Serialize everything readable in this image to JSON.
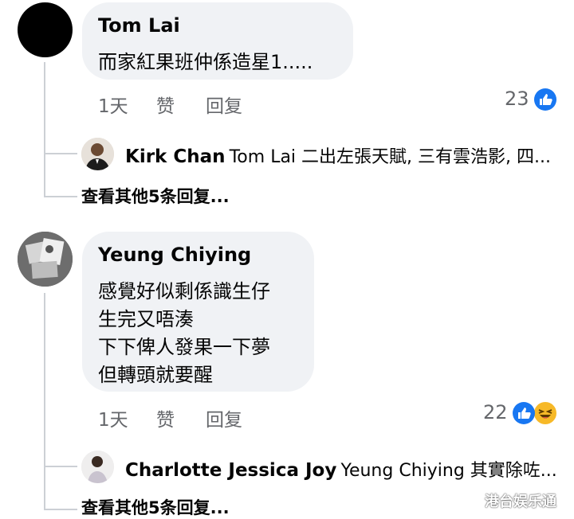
{
  "comments": [
    {
      "author": "Tom Lai",
      "lines": [
        "而家紅果班仲係造星1....."
      ],
      "time": "1天",
      "like_label": "赞",
      "reply_label": "回复",
      "reaction_count": "23",
      "reactions": [
        "like-icon"
      ],
      "reply_preview": {
        "author": "Kirk Chan",
        "text": "Tom Lai 二出左張天賦, 三有雲浩影, 四..."
      },
      "more_replies": "查看其他5条回复..."
    },
    {
      "author": "Yeung Chiying",
      "lines": [
        "感覺好似剩係識生仔",
        "生完又唔湊",
        "下下俾人發果一下夢",
        "但轉頭就要醒"
      ],
      "time": "1天",
      "like_label": "赞",
      "reply_label": "回复",
      "reaction_count": "22",
      "reactions": [
        "like-icon",
        "haha-icon"
      ],
      "reply_preview": {
        "author": "Charlotte Jessica Joy",
        "text": "Yeung Chiying 其實除咗..."
      },
      "more_replies": "查看其他5条回复..."
    }
  ],
  "watermark": "港台娱乐通",
  "colors": {
    "like_blue": "#1877f2",
    "haha_yellow": "#f7b928",
    "bubble_bg": "#f0f2f5",
    "meta_gray": "#65676b",
    "thread_line": "#ccd0d5"
  }
}
